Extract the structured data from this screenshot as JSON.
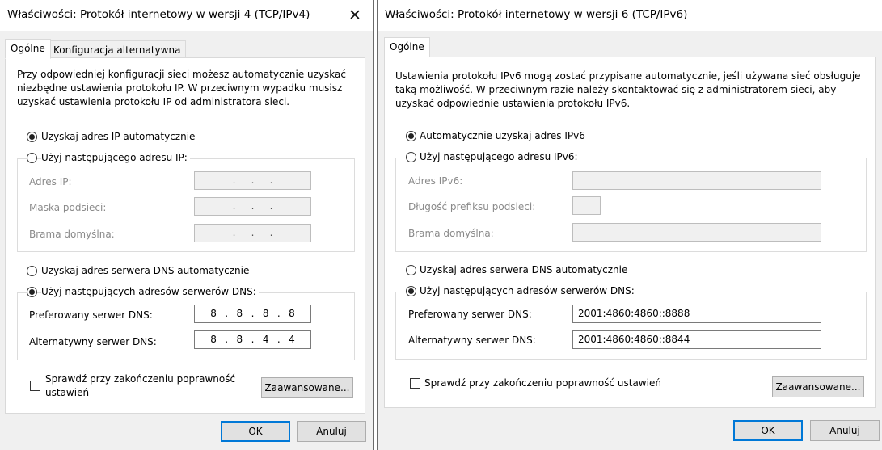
{
  "ipv4": {
    "title": "Właściwości: Protokół internetowy w wersji 4 (TCP/IPv4)",
    "close_glyph": "✕",
    "tabs": [
      "Ogólne",
      "Konfiguracja alternatywna"
    ],
    "description": "Przy odpowiedniej konfiguracji sieci możesz automatycznie uzyskać\nniezbędne ustawienia protokołu IP. W przeciwnym wypadku musisz\nuzyskać ustawienia protokołu IP od administratora sieci.",
    "radio_auto_ip": "Uzyskaj adres IP automatycznie",
    "radio_manual_ip": "Użyj następującego adresu IP:",
    "ip_address_label": "Adres IP:",
    "subnet_label": "Maska podsieci:",
    "gateway_label": "Brama domyślna:",
    "empty_ip_dots": ". . .",
    "radio_auto_dns": "Uzyskaj adres serwera DNS automatycznie",
    "radio_manual_dns": "Użyj następujących adresów serwerów DNS:",
    "preferred_dns_label": "Preferowany serwer DNS:",
    "alternate_dns_label": "Alternatywny serwer DNS:",
    "preferred_dns": [
      "8",
      "8",
      "8",
      "8"
    ],
    "alternate_dns": [
      "8",
      "8",
      "4",
      "4"
    ],
    "validate_label": "Sprawdź przy zakończeniu poprawność\nustawień",
    "advanced_button": "Zaawansowane...",
    "ok_button": "OK",
    "cancel_button": "Anuluj",
    "selected_ip_mode": "auto",
    "selected_dns_mode": "manual",
    "validate_checked": false
  },
  "ipv6": {
    "title": "Właściwości: Protokół internetowy w wersji 6 (TCP/IPv6)",
    "close_glyph": "✕",
    "tabs": [
      "Ogólne"
    ],
    "description": "Ustawienia protokołu IPv6 mogą zostać przypisane automatycznie, jeśli używana sieć obsługuje\ntaką możliwość. W przeciwnym razie należy skontaktować się z administratorem sieci, aby\nuzyskać odpowiednie ustawienia protokołu IPv6.",
    "radio_auto_ip": "Automatycznie uzyskaj adres IPv6",
    "radio_manual_ip": "Użyj następującego adresu IPv6:",
    "ip_address_label": "Adres IPv6:",
    "prefix_label": "Długość prefiksu podsieci:",
    "gateway_label": "Brama domyślna:",
    "radio_auto_dns": "Uzyskaj adres serwera DNS automatycznie",
    "radio_manual_dns": "Użyj następujących adresów serwerów DNS:",
    "preferred_dns_label": "Preferowany serwer DNS:",
    "alternate_dns_label": "Alternatywny serwer DNS:",
    "preferred_dns": "2001:4860:4860::8888",
    "alternate_dns": "2001:4860:4860::8844",
    "validate_label": "Sprawdź przy zakończeniu poprawność ustawień",
    "advanced_button": "Zaawansowane...",
    "ok_button": "OK",
    "cancel_button": "Anuluj",
    "selected_ip_mode": "auto",
    "selected_dns_mode": "manual",
    "validate_checked": false
  },
  "colors": {
    "accent": "#0078d7",
    "dialog_bg": "#f0f0f0",
    "panel_bg": "#ffffff"
  }
}
